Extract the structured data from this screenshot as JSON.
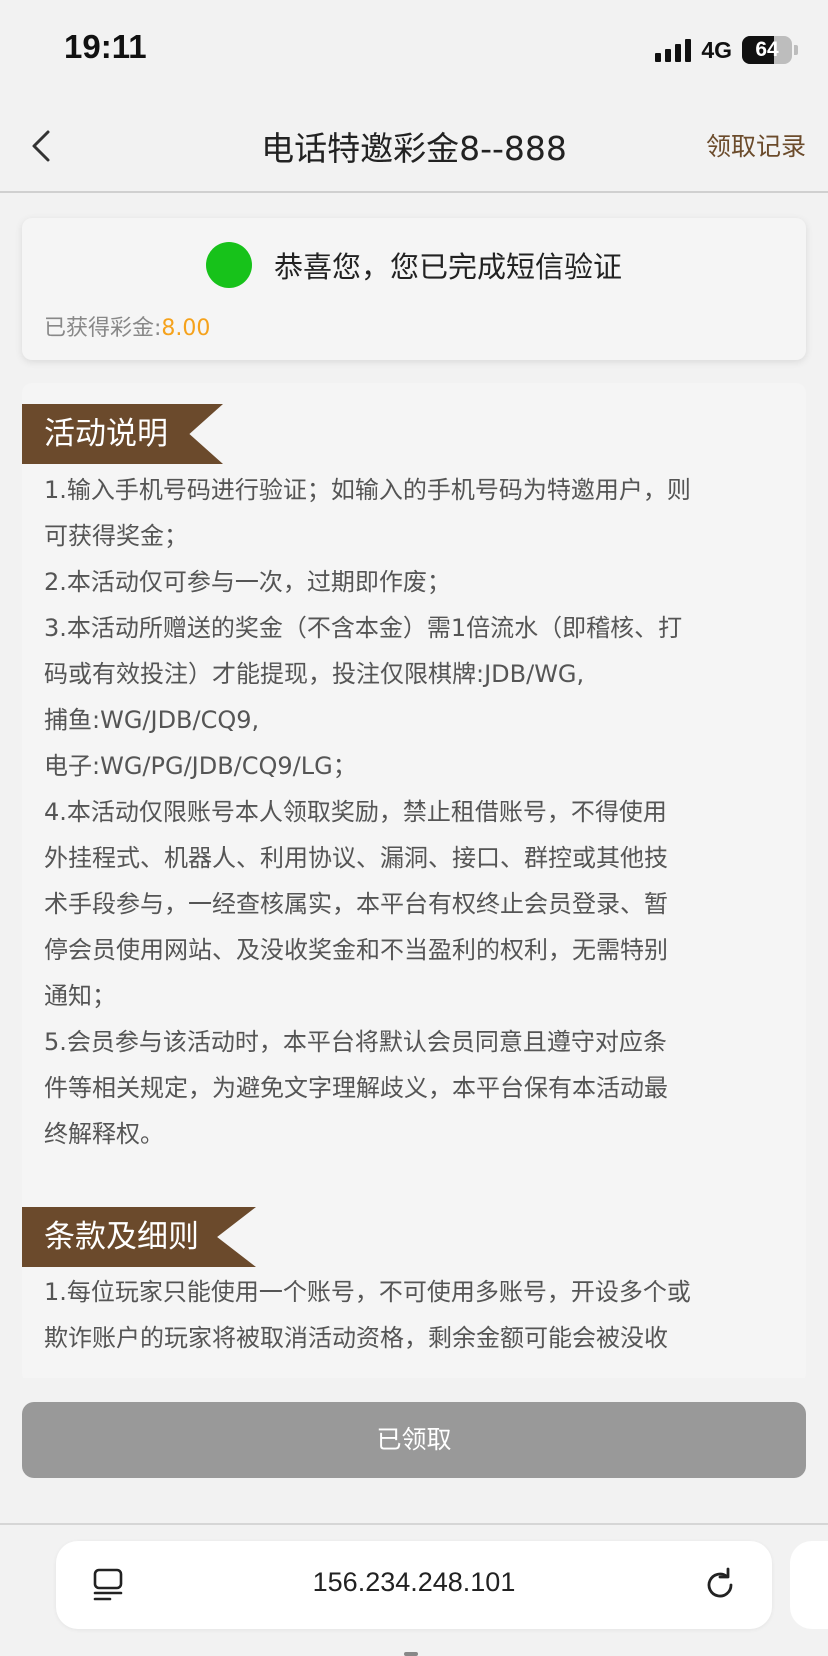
{
  "status_bar": {
    "time": "19:11",
    "network": "4G",
    "battery": "64",
    "battery_level_percent": 64
  },
  "nav": {
    "title": "电话特邀彩金8--888",
    "action_label": "领取记录",
    "back_icon": "chevron-left-icon"
  },
  "success_card": {
    "message": "恭喜您，您已完成短信验证",
    "bonus_label": "已获得彩金:",
    "bonus_value": "8.00",
    "status_color": "#17c21a",
    "value_color": "#f5a21c"
  },
  "section1": {
    "title": "活动说明",
    "lines": [
      "1.输入手机号码进行验证；如输入的手机号码为特邀用户，则",
      "可获得奖金；",
      "2.本活动仅可参与一次，过期即作废；",
      "3.本活动所赠送的奖金（不含本金）需1倍流水（即稽核、打",
      "码或有效投注）才能提现，投注仅限棋牌:JDB/WG,",
      "捕鱼:WG/JDB/CQ9,",
      "电子:WG/PG/JDB/CQ9/LG；",
      "4.本活动仅限账号本人领取奖励，禁止租借账号，不得使用",
      "外挂程式、机器人、利用协议、漏洞、接口、群控或其他技",
      "术手段参与，一经查核属实，本平台有权终止会员登录、暂",
      "停会员使用网站、及没收奖金和不当盈利的权利，无需特别",
      "通知；",
      "5.会员参与该活动时，本平台将默认会员同意且遵守对应条",
      "件等相关规定，为避免文字理解歧义，本平台保有本活动最",
      "终解释权。"
    ]
  },
  "section2": {
    "title": "条款及细则",
    "lines": [
      "1.每位玩家只能使用一个账号，不可使用多账号，开设多个或",
      "欺诈账户的玩家将被取消活动资格，剩余金额可能会被没收"
    ]
  },
  "claim_button": {
    "label": "已领取"
  },
  "browser": {
    "url": "156.234.248.101",
    "tabs_icon": "tabs-icon",
    "reload_icon": "reload-icon"
  },
  "colors": {
    "ribbon": "#6b4a2c",
    "button_disabled": "#999999"
  }
}
